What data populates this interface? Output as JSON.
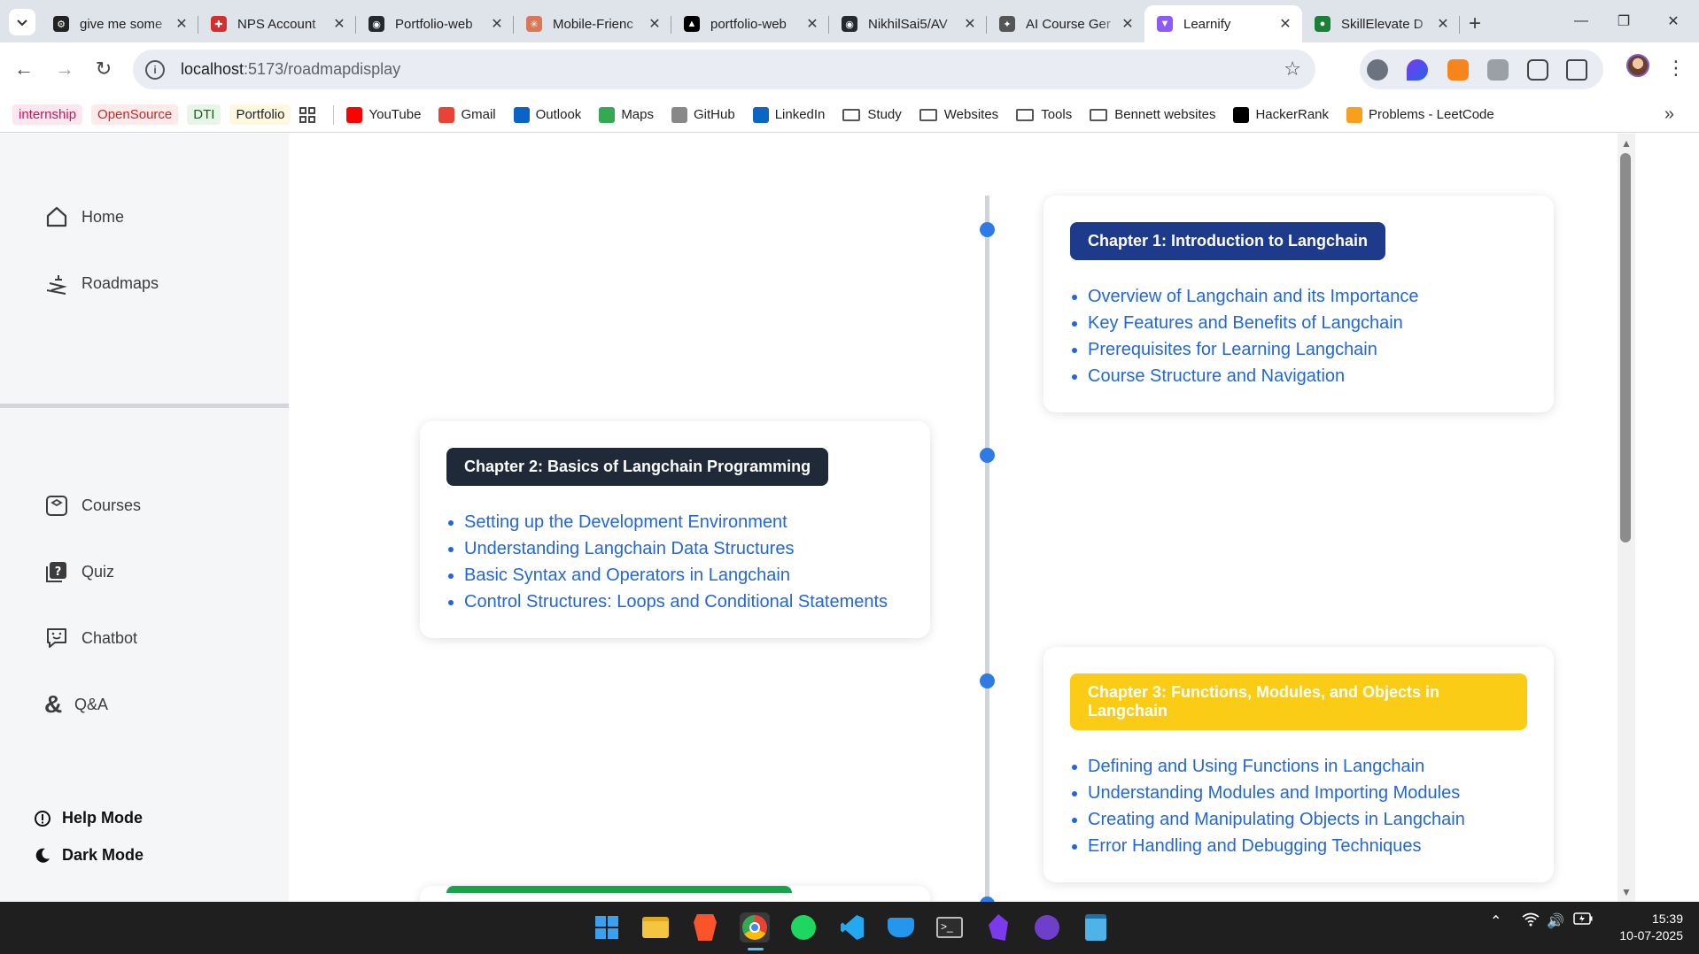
{
  "browser": {
    "tabs": [
      {
        "title": "give me some",
        "favicon_color": "#222222",
        "favicon_glyph": "⚙"
      },
      {
        "title": "NPS Account",
        "favicon_color": "#d32f2f",
        "favicon_glyph": "✚"
      },
      {
        "title": "Portfolio-web",
        "favicon_color": "#24292f",
        "favicon_glyph": "◉"
      },
      {
        "title": "Mobile-Frienc",
        "favicon_color": "#d97757",
        "favicon_glyph": "✳"
      },
      {
        "title": "portfolio-web",
        "favicon_color": "#000000",
        "favicon_glyph": "▲"
      },
      {
        "title": "NikhilSai5/AV",
        "favicon_color": "#24292f",
        "favicon_glyph": "◉"
      },
      {
        "title": "AI Course Ger",
        "favicon_color": "#555555",
        "favicon_glyph": "✦"
      },
      {
        "title": "Learnify",
        "favicon_color": "#8b5cf6",
        "favicon_glyph": "▼",
        "active": true
      },
      {
        "title": "SkillElevate D",
        "favicon_color": "#1a7f37",
        "favicon_glyph": "●"
      }
    ],
    "new_tab_symbol": "+",
    "url_host": "localhost",
    "url_path": ":5173/roadmapdisplay",
    "bookmarks": {
      "chips": [
        {
          "label": "internship",
          "color": "#c2185b",
          "bg": "#fde7ef"
        },
        {
          "label": "OpenSource",
          "color": "#c62828",
          "bg": "#fdeaea"
        },
        {
          "label": "DTI",
          "color": "#1b5e20",
          "bg": "#e8f5e9"
        },
        {
          "label": "Portfolio",
          "color": "#1f1f1f",
          "bg": "#fff8e1"
        }
      ],
      "links": [
        {
          "label": "YouTube",
          "icon": "youtube-icon",
          "color": "#ff0000"
        },
        {
          "label": "Gmail",
          "icon": "gmail-icon",
          "color": "#ea4335"
        },
        {
          "label": "Outlook",
          "icon": "outlook-icon",
          "color": "#0a64c8"
        },
        {
          "label": "Maps",
          "icon": "maps-icon",
          "color": "#34a853"
        },
        {
          "label": "GitHub",
          "icon": "github-icon",
          "color": "#888888"
        },
        {
          "label": "LinkedIn",
          "icon": "linkedin-icon",
          "color": "#0a66c2"
        }
      ],
      "folders": [
        "Study",
        "Websites",
        "Tools",
        "Bennett websites"
      ],
      "extra_links": [
        {
          "label": "HackerRank",
          "icon": "hackerrank-icon",
          "color": "#000000"
        },
        {
          "label": "Problems - LeetCode",
          "icon": "leetcode-icon",
          "color": "#f89f1b"
        }
      ]
    }
  },
  "sidebar": {
    "items_top": [
      {
        "label": "Home",
        "icon": "home-icon"
      },
      {
        "label": "Roadmaps",
        "icon": "roadmap-icon"
      }
    ],
    "items_mid": [
      {
        "label": "Courses",
        "icon": "courses-icon"
      },
      {
        "label": "Quiz",
        "icon": "quiz-icon"
      },
      {
        "label": "Chatbot",
        "icon": "chatbot-icon"
      },
      {
        "label": "Q&A",
        "icon": "qa-icon"
      }
    ],
    "help_mode": "Help Mode",
    "dark_mode": "Dark Mode"
  },
  "roadmap": {
    "chapters": [
      {
        "title": "Chapter 1: Introduction to Langchain",
        "color": "#1e3a8a",
        "topics": [
          "Overview of Langchain and its Importance",
          "Key Features and Benefits of Langchain",
          "Prerequisites for Learning Langchain",
          "Course Structure and Navigation"
        ]
      },
      {
        "title": "Chapter 2: Basics of Langchain Programming",
        "color": "#1f2937",
        "topics": [
          "Setting up the Development Environment",
          "Understanding Langchain Data Structures",
          "Basic Syntax and Operators in Langchain",
          "Control Structures: Loops and Conditional Statements"
        ]
      },
      {
        "title": "Chapter 3: Functions, Modules, and Objects in Langchain",
        "color": "#facc15",
        "topics": [
          "Defining and Using Functions in Langchain",
          "Understanding Modules and Importing Modules",
          "Creating and Manipulating Objects in Langchain",
          "Error Handling and Debugging Techniques"
        ]
      }
    ],
    "accent_color": "#2f7be5",
    "next_chapter_color": "#16a34a"
  },
  "taskbar": {
    "time": "15:39",
    "date": "10-07-2025"
  }
}
